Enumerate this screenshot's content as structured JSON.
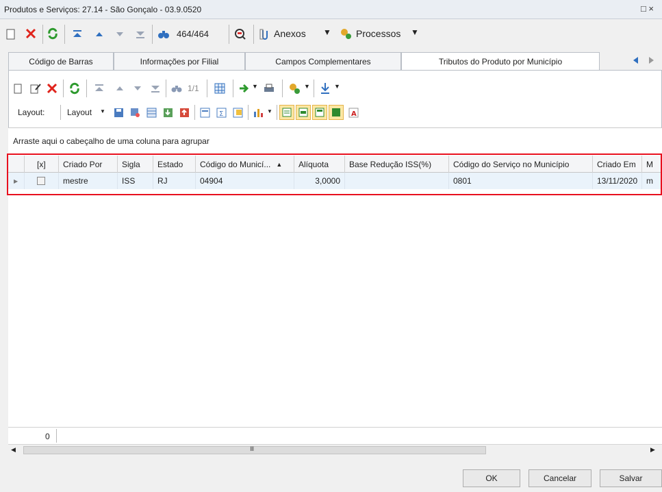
{
  "window": {
    "title": "Produtos e Serviços: 27.14 - São Gonçalo - 03.9.0520",
    "maximize_glyph": "□ ×"
  },
  "toolbar1": {
    "record_count": "464/464",
    "anexos_label": "Anexos",
    "processos_label": "Processos",
    "icons": [
      "new-icon",
      "delete-icon",
      "refresh-icon",
      "first-icon",
      "prev-icon",
      "next-icon",
      "last-icon",
      "find-icon",
      "query-icon",
      "attach-icon",
      "process-icon"
    ]
  },
  "tabs": [
    {
      "label": "Código de Barras",
      "active": false
    },
    {
      "label": "Informações por Filial",
      "active": false
    },
    {
      "label": "Campos Complementares",
      "active": false
    },
    {
      "label": "Tributos do Produto por Município",
      "active": true
    }
  ],
  "toolbar2": {
    "page_count": "1/1"
  },
  "toolbar3": {
    "layout_label": "Layout:",
    "layout_dropdown": "Layout"
  },
  "grid": {
    "group_hint": "Arraste aqui o cabeçalho de uma coluna para agrupar",
    "columns": [
      "[x]",
      "Criado Por",
      "Sigla",
      "Estado",
      "Código do Municí...",
      "Alíquota",
      "Base Redução ISS(%)",
      "Código do Serviço no Município",
      "Criado Em",
      "M"
    ],
    "rows": [
      [
        "",
        "mestre",
        "ISS",
        "RJ",
        "04904",
        "3,0000",
        "",
        "0801",
        "13/11/2020",
        "m"
      ]
    ],
    "footer_count": "0"
  },
  "buttons": {
    "ok": "OK",
    "cancel": "Cancelar",
    "save": "Salvar"
  },
  "colors": {
    "highlight": "#e8101e",
    "selected_row": "#eaf3fb",
    "accent_blue": "#2f6fbf"
  }
}
